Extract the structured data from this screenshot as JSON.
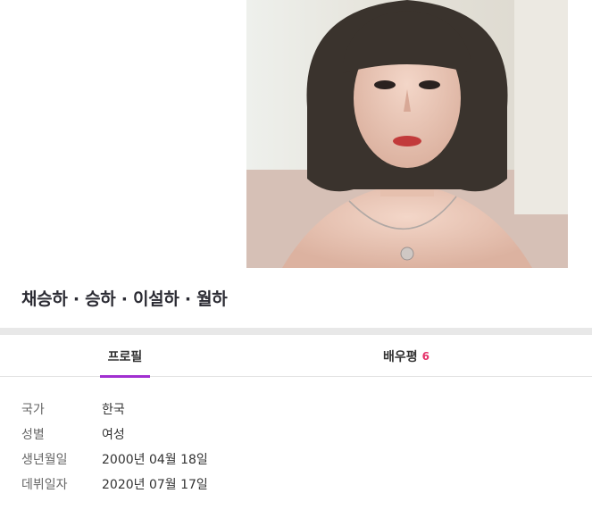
{
  "actor": {
    "names": "채승하 · 승하 · 이설하 · 월하"
  },
  "tabs": {
    "profile_label": "프로필",
    "review_label": "배우평",
    "review_count": "6"
  },
  "profile": {
    "rows": [
      {
        "label": "국가",
        "value": "한국"
      },
      {
        "label": "성별",
        "value": "여성"
      },
      {
        "label": "생년월일",
        "value": "2000년 04월 18일"
      },
      {
        "label": "데뷔일자",
        "value": "2020년 07월 17일"
      }
    ]
  },
  "colors": {
    "accent": "#a12fd0",
    "count": "#e5326a",
    "band": "#e8e8e8"
  }
}
